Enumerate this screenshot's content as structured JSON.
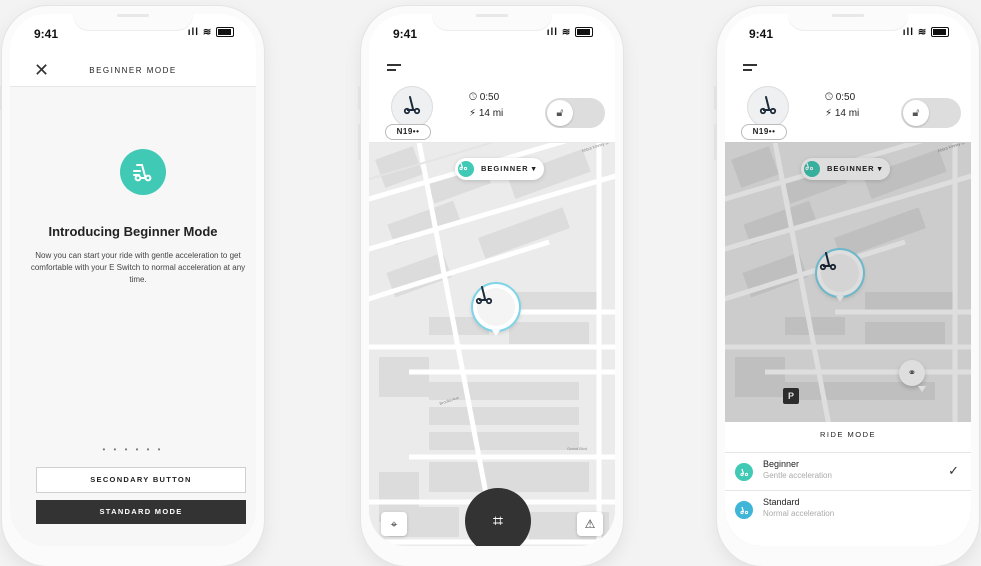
{
  "status": {
    "time": "9:41",
    "signal": "ıll"
  },
  "colors": {
    "accent": "#40c9b5",
    "accent_blue": "#3fb6d8",
    "dark": "#333333"
  },
  "phone1": {
    "header_title": "BEGINNER MODE",
    "close_icon": "close-icon",
    "heading": "Introducing Beginner Mode",
    "description": "Now you can start your ride with gentle acceleration to get comfortable with your E Switch to normal acceleration at any time.",
    "pager": "• • • • • •",
    "secondary_button": "SECONDARY BUTTON",
    "primary_button": "STANDARD MODE"
  },
  "phone2": {
    "vehicle_tag": "N19••",
    "duration": "0:50",
    "range": "14 mi",
    "mode_pill": "BEGINNER",
    "map_labels": {
      "street1": "Abbot Kinney Bl",
      "street2": "Grand Blvd",
      "street3": "Brooks Ave"
    }
  },
  "phone3": {
    "vehicle_tag": "N19••",
    "duration": "0:50",
    "range": "14 mi",
    "mode_pill": "BEGINNER",
    "sheet_title": "RIDE MODE",
    "options": [
      {
        "name": "Beginner",
        "sub": "Gentle acceleration",
        "selected": true
      },
      {
        "name": "Standard",
        "sub": "Normal acceleration",
        "selected": false
      }
    ],
    "parking": "P"
  }
}
